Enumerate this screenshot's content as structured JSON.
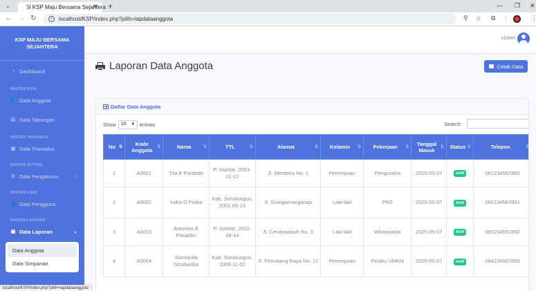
{
  "browser": {
    "tab_title": "SI KSP Maju Bersama Sejahtera",
    "url": "localhost/KSP/index.php?pilih=lapdataanggota",
    "status_url": "localhost/KSP/index.php?pilih=lapdataanggota"
  },
  "sidebar": {
    "brand": "KSP MAJU BERSAMA SEJAHTERA",
    "dashboard": "Dashboard",
    "headings": {
      "master_data": "MASTER DATA",
      "master_transaksi": "MASTER TRANSAKSI",
      "master_setting": "MASTER SETTING",
      "master_user": "MASTER USER",
      "master_laporan": "MASTER LAPORAN"
    },
    "items": {
      "data_anggota": "Data Anggota",
      "data_tabungan": "Data Tabungan",
      "data_transaksi": "Data Transaksi",
      "data_pengaturan": "Data Pengaturan",
      "data_pengguna": "Data Pengguna",
      "data_laporan": "Data Laporan"
    },
    "submenu": {
      "data_anggota": "Data Anggota",
      "data_simpanan": "Data Simpanan"
    }
  },
  "topbar": {
    "user": "ADMIN"
  },
  "page": {
    "title": "Laporan Data Anggota",
    "print_button": "Cetak Data",
    "card_title": "Daftar Data Anggota"
  },
  "table_controls": {
    "show": "Show",
    "entries_value": "10",
    "entries": "entries",
    "search": "Search:"
  },
  "table": {
    "headers": [
      "No",
      "Kode Anggota",
      "Nama",
      "TTL",
      "Alamat",
      "Kelamin",
      "Pekerjaan",
      "Tanggal Masuk",
      "Status",
      "Telepon"
    ],
    "rows": [
      [
        "1",
        "A0001",
        "Tita E Pardede",
        "P. Siantar, 2003-01-12",
        "Jl. Merdeka No. 1",
        "Perempuan",
        "Pengusaha",
        "2025-05-07",
        "Aktif",
        "081234567890"
      ],
      [
        "2",
        "A0002",
        "Indra D Purba",
        "Kab. Simalungun, 2001-05-23",
        "Jl. Sisingamangaraja",
        "Laki-laki",
        "PNS",
        "2025-05-07",
        "Aktif",
        "082134567891"
      ],
      [
        "3",
        "A0003",
        "Antonius E Pasaribu",
        "P. Siantar, 2002-08-14",
        "Jl. Cendrawasih No. 5",
        "Laki-laki",
        "Wiraswasta",
        "2025-05-07",
        "Aktif",
        "083234567892"
      ],
      [
        "4",
        "A0004",
        "Samianifa Sinabariba",
        "Kab. Simalungun, 2000-11-02",
        "Jl. Pematang Raya No. 12",
        "Perempuan",
        "Pelaku UMKM",
        "2025-05-07",
        "Aktif",
        "084234567893"
      ]
    ]
  },
  "colors": {
    "primary": "#4e73df",
    "success": "#1cc88a",
    "sidebar": "#4e73df"
  }
}
